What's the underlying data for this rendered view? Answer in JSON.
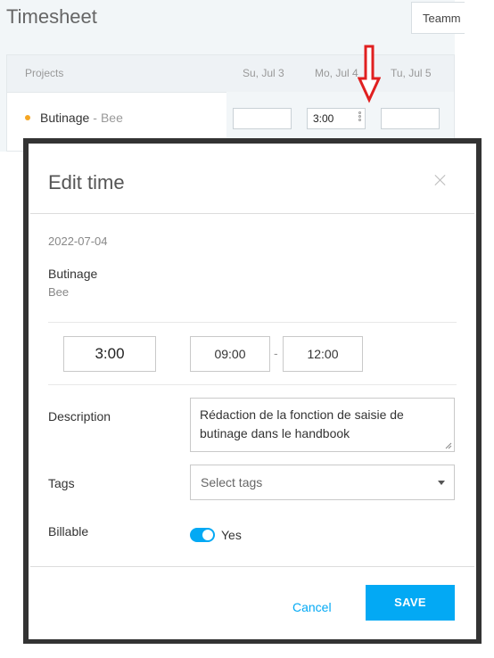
{
  "page": {
    "title": "Timesheet",
    "team_button": "Teamm"
  },
  "table": {
    "headers": {
      "projects": "Projects",
      "days": [
        "Su, Jul 3",
        "Mo, Jul 4",
        "Tu, Jul 5"
      ]
    },
    "row": {
      "project": "Butinage",
      "separator": "-",
      "client": "Bee",
      "dot_color": "#f5a623",
      "values": [
        "",
        "3:00",
        "",
        ""
      ]
    }
  },
  "annotation": {
    "arrow_color": "#e02020"
  },
  "modal": {
    "title": "Edit time",
    "date": "2022-07-04",
    "project": "Butinage",
    "client": "Bee",
    "duration": "3:00",
    "start_time": "09:00",
    "time_separator": "-",
    "end_time": "12:00",
    "description_label": "Description",
    "description_value": "Rédaction de la fonction de saisie de butinage dans le handbook",
    "tags_label": "Tags",
    "tags_placeholder": "Select tags",
    "billable_label": "Billable",
    "billable_value": "Yes",
    "billable_on": true,
    "cancel_label": "Cancel",
    "save_label": "SAVE"
  },
  "colors": {
    "accent": "#03a9f4",
    "frame": "#333333",
    "background": "#f2f6f8"
  }
}
